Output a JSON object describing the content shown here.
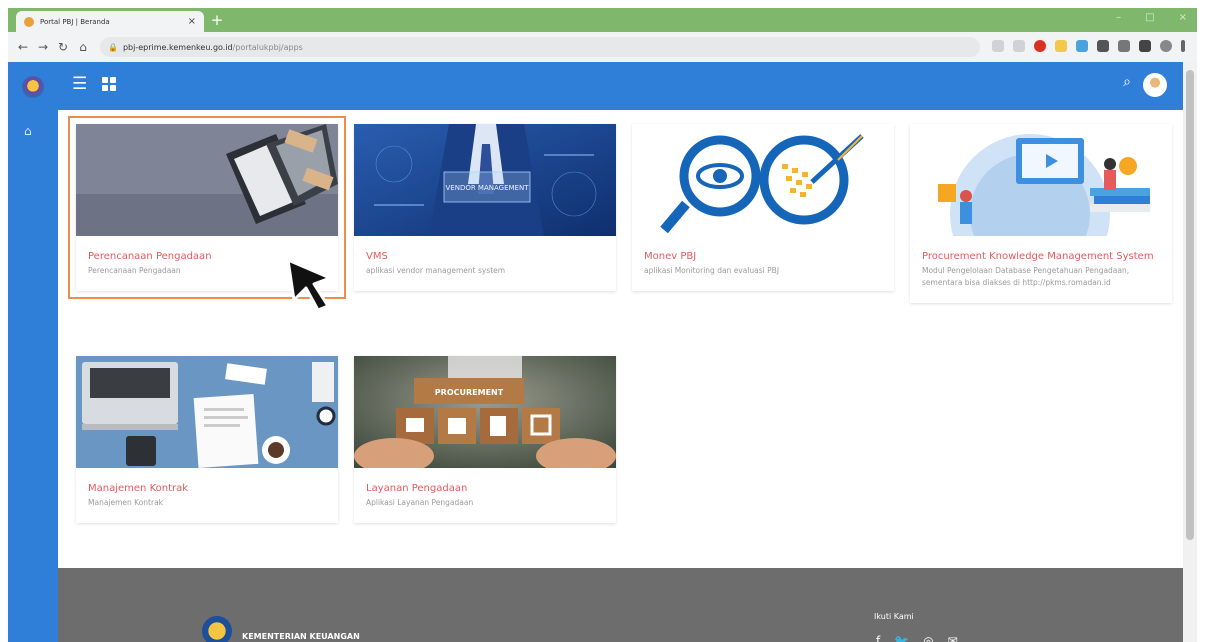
{
  "browser": {
    "tab_title": "Portal PBJ | Beranda",
    "tab_close": "×",
    "new_tab": "+",
    "url_host": "pbj-eprime.kemenkeu.go.id",
    "url_path": "/portalukpbj/apps",
    "win_min": "–",
    "win_max": "□",
    "win_close": "×"
  },
  "cards": [
    {
      "title": "Perencanaan Pengadaan",
      "desc": "Perencanaan Pengadaan"
    },
    {
      "title": "VMS",
      "desc": "aplikasi vendor management system"
    },
    {
      "title": "Monev PBJ",
      "desc": "aplikasi Monitoring dan evaluasi PBJ"
    },
    {
      "title": "Procurement Knowledge Management System",
      "desc": "Modul Pengelolaan Database Pengetahuan Pengadaan, sementara bisa diakses di http://pkms.romadan.id"
    },
    {
      "title": "Manajemen Kontrak",
      "desc": "Manajemen Kontrak"
    },
    {
      "title": "Layanan Pengadaan",
      "desc": "Aplikasi Layanan Pengadaan"
    }
  ],
  "images": {
    "vms_banner": "VENDOR MANAGEMENT",
    "procurement_sign": "PROCUREMENT"
  },
  "footer": {
    "org_name": "KEMENTERIAN KEUANGAN",
    "follow_label": "Ikuti Kami"
  },
  "colors": {
    "primary": "#2f7ed8",
    "card_title": "#e35b5b",
    "selected_outline": "#f08c4a",
    "footer_bg": "#6d6d6d"
  }
}
